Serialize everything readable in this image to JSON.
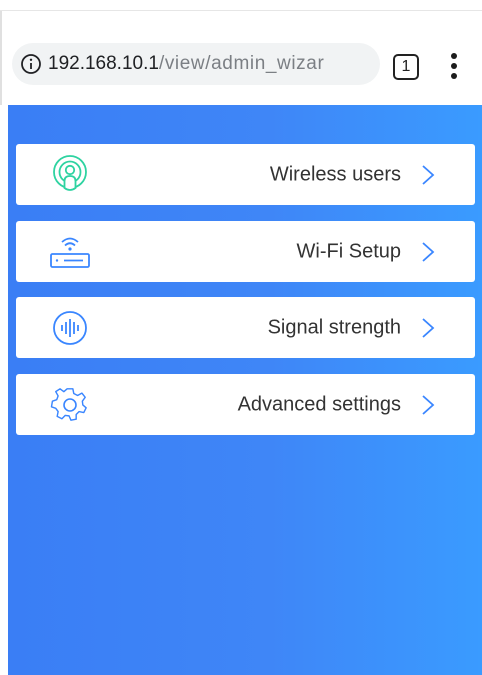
{
  "browser": {
    "url_host": "192.168.10.1",
    "url_path": "/view/admin_wizar",
    "tab_count": "1",
    "info_icon": "info-icon",
    "menu_icon": "more-vert-icon"
  },
  "menu": {
    "items": [
      {
        "label": "Wireless users",
        "icon": "wireless-users-icon",
        "icon_color": "#2ed3a1"
      },
      {
        "label": "Wi-Fi Setup",
        "icon": "router-wifi-icon",
        "icon_color": "#3a86ff"
      },
      {
        "label": "Signal strength",
        "icon": "signal-strength-icon",
        "icon_color": "#3a86ff"
      },
      {
        "label": "Advanced settings",
        "icon": "gear-icon",
        "icon_color": "#3a86ff"
      }
    ],
    "chevron_icon": "chevron-right-icon"
  },
  "colors": {
    "accent": "#3a86ff",
    "background_start": "#3a7ef5",
    "background_end": "#3a9bff",
    "text": "#333333"
  }
}
